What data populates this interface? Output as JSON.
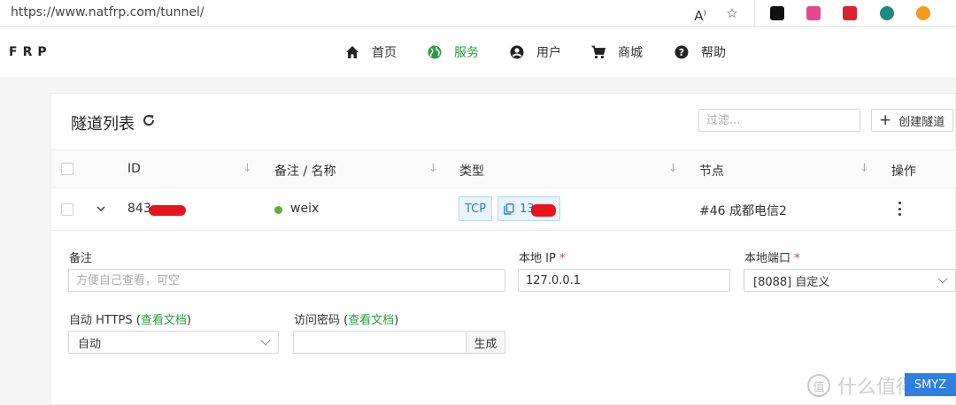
{
  "browser": {
    "url": "https://www.natfrp.com/tunnel/"
  },
  "nav": {
    "logo": "FRP",
    "items": [
      {
        "label": "首页",
        "icon": "home-icon"
      },
      {
        "label": "服务",
        "icon": "globe-icon",
        "active": true
      },
      {
        "label": "用户",
        "icon": "user-icon"
      },
      {
        "label": "商城",
        "icon": "cart-icon"
      },
      {
        "label": "帮助",
        "icon": "help-icon"
      }
    ]
  },
  "page": {
    "title": "隧道列表",
    "filter_placeholder": "过滤...",
    "create_label": "创建隧道"
  },
  "table": {
    "headers": [
      "ID",
      "备注 / 名称",
      "类型",
      "节点",
      "操作"
    ],
    "row": {
      "id": "843",
      "name": "weix",
      "type": "TCP",
      "port": "13",
      "node": "#46 成都电信2"
    }
  },
  "detail": {
    "note_label": "备注",
    "note_placeholder": "方便自己查看，可空",
    "local_ip_label": "本地 IP",
    "local_ip_value": "127.0.0.1",
    "local_port_label": "本地端口",
    "local_port_value": "[8088] 自定义",
    "https_label": "自动 HTTPS",
    "https_doc": "查看文档",
    "https_value": "自动",
    "password_label": "访问密码",
    "password_doc": "查看文档",
    "generate_label": "生成",
    "required_mark": "*"
  },
  "watermark": {
    "text": "什么值得买",
    "badge": "值",
    "overlay": "SMYZ"
  },
  "colors": {
    "accent": "#2e9c47",
    "tag_blue": "#2b7fcd",
    "status_green": "#6aa832"
  }
}
